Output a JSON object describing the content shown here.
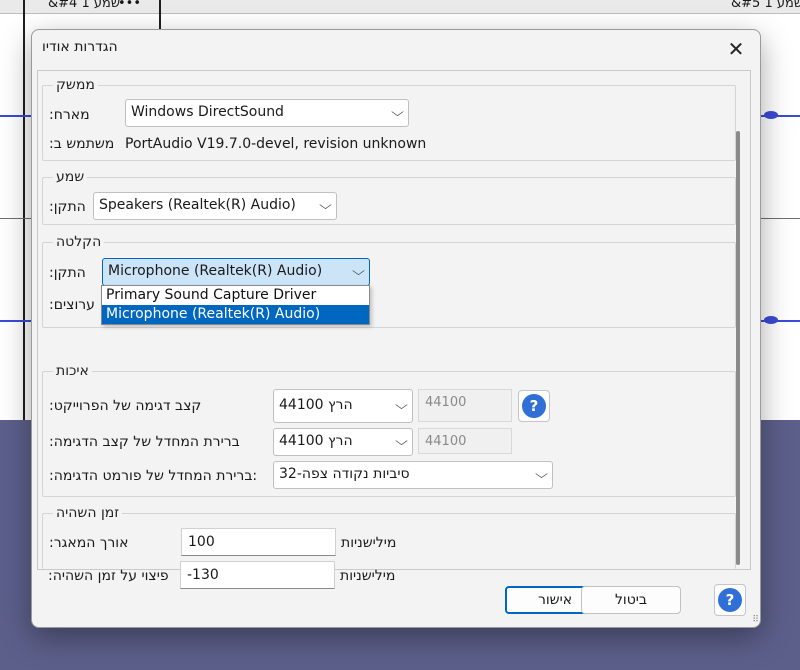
{
  "background": {
    "track_left_label": "&#4 שמע 1",
    "track_left_menu": "•••",
    "track_right_label": "&#5 שמע 1"
  },
  "dialog": {
    "title": "הגדרות אודיו",
    "close_glyph": "✕"
  },
  "interface": {
    "group_title": "ממשק",
    "host_label": ":מארח",
    "host_value": "Windows DirectSound",
    "using_label": ":משתמש ב",
    "using_value": "PortAudio V19.7.0-devel, revision unknown"
  },
  "playback": {
    "group_title": "שמע",
    "device_label": ":התקן",
    "device_value": "Speakers (Realtek(R) Audio)"
  },
  "recording": {
    "group_title": "הקלטה",
    "device_label": ":התקן",
    "device_value": "Microphone (Realtek(R) Audio)",
    "channels_label": ":ערוצים",
    "dropdown_options": [
      "Primary Sound Capture Driver",
      "Microphone (Realtek(R) Audio)"
    ],
    "dropdown_selected_index": 1
  },
  "quality": {
    "group_title": "איכות",
    "project_rate_label": ":קצב דגימה של הפרוייקט",
    "project_rate_value": "44100 הרץ",
    "project_rate_field": "44100",
    "default_rate_label": ":ברירת המחדל של קצב הדגימה",
    "default_rate_value": "44100 הרץ",
    "default_rate_field": "44100",
    "default_format_label": ":ברירת המחדל של פורמט הדגימה:",
    "default_format_value": "32-סיביות נקודה צפה"
  },
  "latency": {
    "group_title": "זמן השהיה",
    "buffer_label": ":אורך המאגר",
    "buffer_value": "100",
    "buffer_unit": "מילישניות",
    "compensation_label": ":פיצוי על זמן השהיה",
    "compensation_value": "-130",
    "compensation_unit": "מילישניות"
  },
  "buttons": {
    "ok_label": "אישור",
    "cancel_label": "ביטול",
    "help_glyph": "?"
  },
  "colors": {
    "accent": "#0067c0",
    "help_icon": "#2f6fd6",
    "waveform": "#3a4bd6",
    "background_lower": "#5c5f8a"
  }
}
